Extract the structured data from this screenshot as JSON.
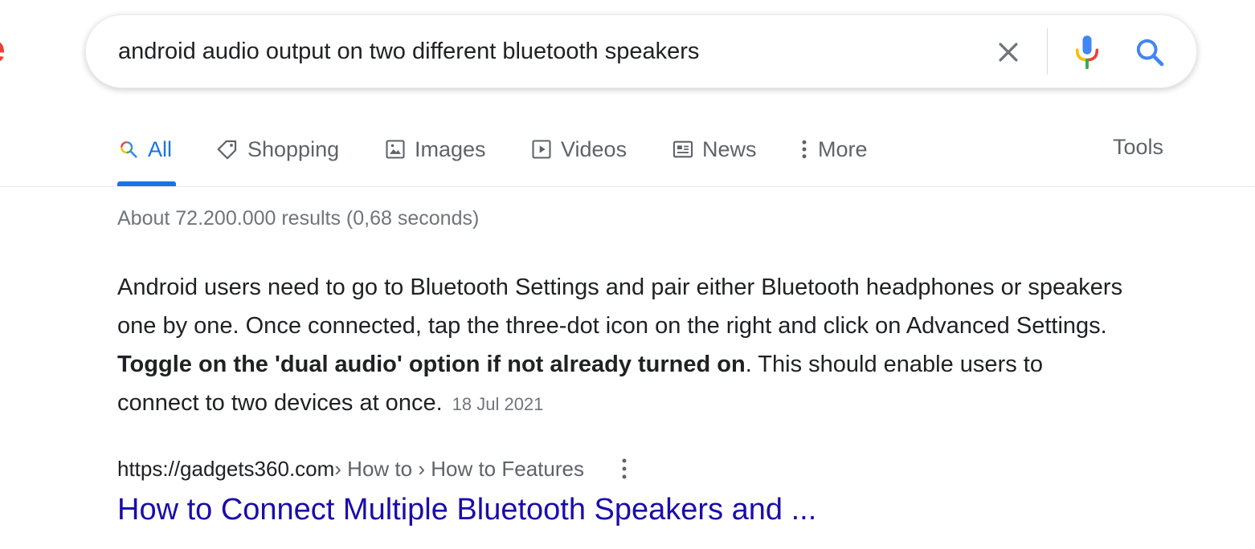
{
  "logo": {
    "fragment": "e"
  },
  "search": {
    "query": "android audio output on two different bluetooth speakers",
    "clear_icon": "close-icon",
    "voice_icon": "microphone-icon",
    "search_icon": "search-icon"
  },
  "tabs": [
    {
      "label": "All",
      "icon": "search-multicolor-icon",
      "active": true
    },
    {
      "label": "Shopping",
      "icon": "tag-icon",
      "active": false
    },
    {
      "label": "Images",
      "icon": "image-icon",
      "active": false
    },
    {
      "label": "Videos",
      "icon": "play-icon",
      "active": false
    },
    {
      "label": "News",
      "icon": "newspaper-icon",
      "active": false
    },
    {
      "label": "More",
      "icon": "more-vertical-icon",
      "active": false
    }
  ],
  "tools_label": "Tools",
  "result_stats": "About 72.200.000 results (0,68 seconds)",
  "featured_snippet": {
    "text_before_bold": "Android users need to go to Bluetooth Settings and pair either Bluetooth headphones or speakers one by one. Once connected, tap the three-dot icon on the right and click on Advanced Settings. ",
    "bold_text": "Toggle on the 'dual audio' option if not already turned on",
    "text_after_bold": ". This should enable users to connect to two devices at once.",
    "date": "18 Jul 2021"
  },
  "result": {
    "cite_domain": "https://gadgets360.com",
    "cite_path": " › How to › How to Features",
    "title": "How to Connect Multiple Bluetooth Speakers and ..."
  },
  "colors": {
    "accent": "#1a73e8",
    "link": "#1a0dab",
    "muted": "#70757a",
    "logo_red": "#ea4335"
  }
}
